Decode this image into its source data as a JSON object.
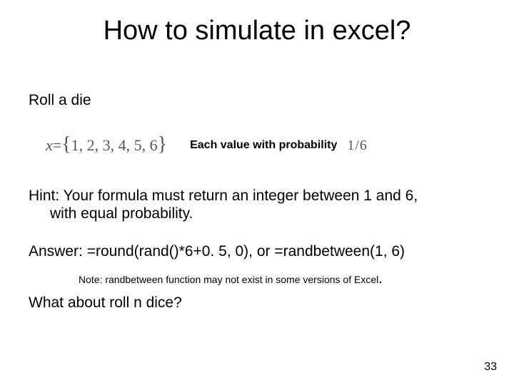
{
  "title": "How to simulate in excel?",
  "roll": "Roll a die",
  "equation": {
    "x_var": "x",
    "equals": " = ",
    "lbrace": "{",
    "set": "1, 2, 3, 4, 5, 6",
    "rbrace": "}",
    "caption": "Each value with probability",
    "prob_num": "1",
    "prob_slash": "/",
    "prob_den": "6"
  },
  "hint_line1": "Hint: Your formula must return an integer between 1 and 6,",
  "hint_line2": "with equal probability.",
  "answer": "Answer: =round(rand()*6+0. 5, 0), or =randbetween(1, 6)",
  "note_text": "Note: randbetween function may not exist in some versions of Excel",
  "note_period": ".",
  "what_about": "What about roll n dice?",
  "page_number": "33"
}
